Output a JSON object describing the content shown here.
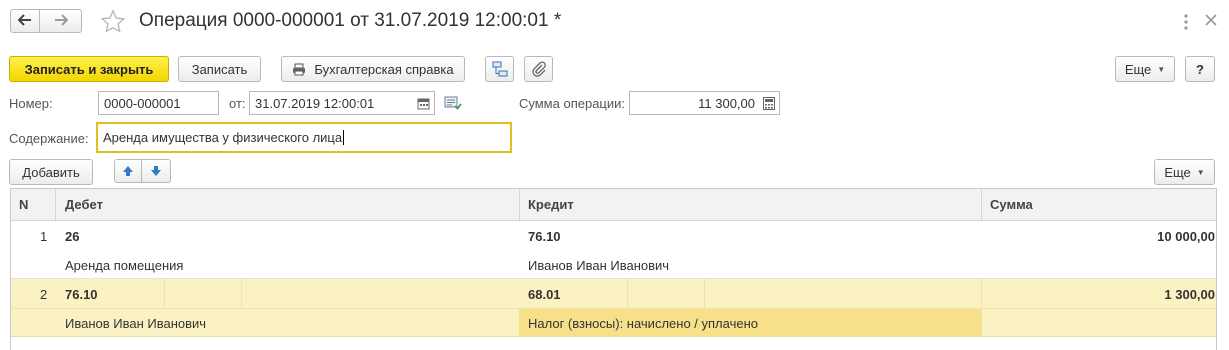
{
  "header": {
    "title": "Операция 0000-000001 от 31.07.2019 12:00:01 *",
    "more_icon": "vertical-dots-icon",
    "close_icon": "close-icon",
    "star_icon": "star-outline-icon"
  },
  "toolbar": {
    "save_close_label": "Записать и закрыть",
    "save_label": "Записать",
    "report_label": "Бухгалтерская справка",
    "more_label": "Еще",
    "help_label": "?"
  },
  "form": {
    "number_label": "Номер:",
    "number_value": "0000-000001",
    "date_label": "от:",
    "date_value": "31.07.2019 12:00:01",
    "sum_label": "Сумма операции:",
    "sum_value": "11 300,00",
    "content_label": "Содержание:",
    "content_value": "Аренда имущества у физического лица"
  },
  "table_toolbar": {
    "add_label": "Добавить",
    "more_label": "Еще"
  },
  "table": {
    "columns": [
      "N",
      "Дебет",
      "Кредит",
      "Сумма"
    ],
    "rows": [
      {
        "n": "1",
        "debit": "26",
        "debit_sub": "Аренда помещения",
        "credit": "76.10",
        "credit_sub": "Иванов Иван Иванович",
        "sum": "10 000,00"
      },
      {
        "n": "2",
        "debit": "76.10",
        "debit_sub": "Иванов Иван Иванович",
        "credit": "68.01",
        "credit_sub": "Налог (взносы): начислено / уплачено",
        "sum": "1 300,00"
      }
    ]
  },
  "colors": {
    "primary_button": "#f5d80a",
    "selected_row": "#fbf2c4",
    "selected_cell": "#f7e08a",
    "focus_border": "#e0c020"
  }
}
